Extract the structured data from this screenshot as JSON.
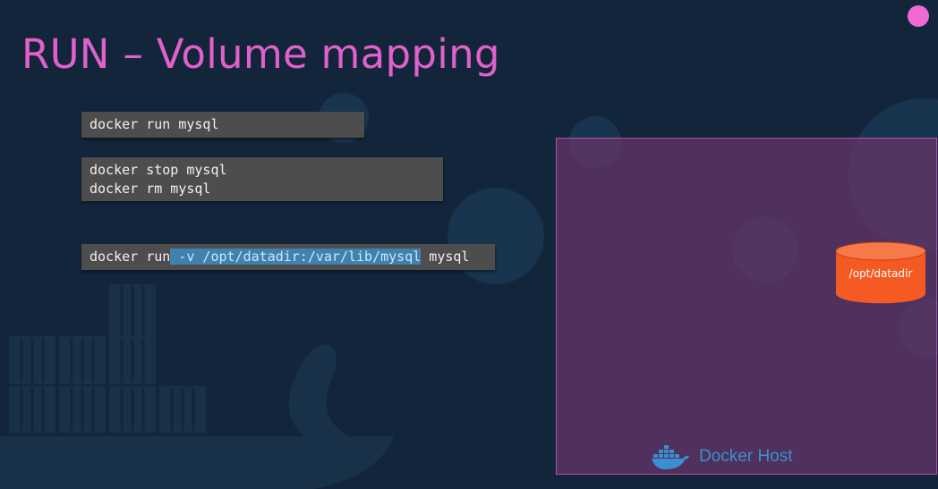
{
  "slide": {
    "title": "RUN – Volume mapping",
    "accent_color": "#e061c9",
    "background_color": "#12253a"
  },
  "commands": [
    {
      "lines": [
        "docker run mysql"
      ]
    },
    {
      "lines": [
        "docker stop mysql",
        "docker rm mysql"
      ]
    },
    {
      "prefix": "docker run",
      "highlight": " -v /opt/datadir:/var/lib/mysql",
      "suffix": " mysql",
      "highlight_color": "#3f82b0"
    }
  ],
  "docker_host": {
    "label": "Docker Host",
    "icon": "docker-whale-icon",
    "fill_color": "#78377380",
    "label_color": "#3b8fd1"
  },
  "volume": {
    "label": "/opt/datadir",
    "icon": "cylinder-volume-icon",
    "color": "#f45a22"
  }
}
